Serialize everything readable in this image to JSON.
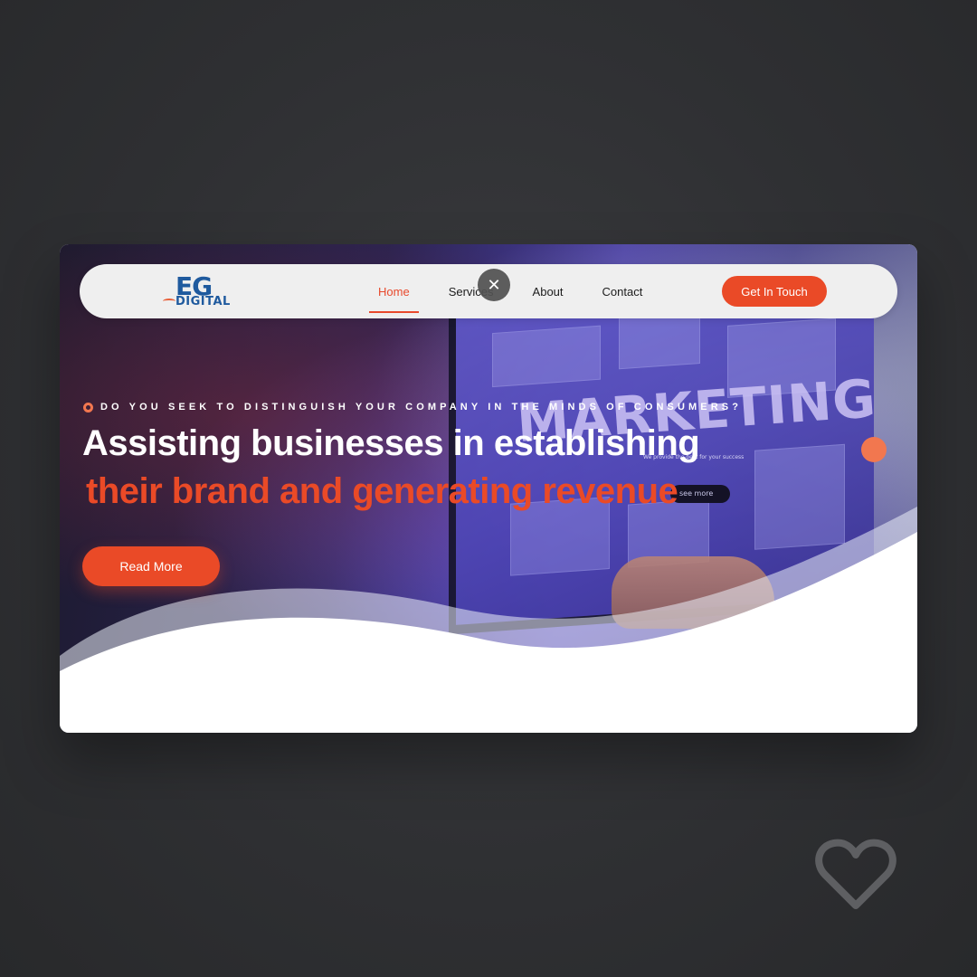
{
  "brand": {
    "logo_main": "EG",
    "logo_sub": "DIGITAL",
    "colors": {
      "accent": "#ea4a27",
      "logo_blue": "#1f5a9e",
      "dot": "#f2774f"
    }
  },
  "nav": {
    "items": [
      {
        "label": "Home",
        "active": true
      },
      {
        "label": "Services",
        "active": false
      },
      {
        "label": "About",
        "active": false
      },
      {
        "label": "Contact",
        "active": false
      }
    ],
    "cta_label": "Get In Touch"
  },
  "overlay": {
    "close_icon": "close-icon",
    "close_glyph": "✕"
  },
  "hero": {
    "eyebrow": "DO YOU SEEK TO DISTINGUISH YOUR COMPANY IN THE MINDS OF CONSUMERS?",
    "headline_line1": "Assisting businesses in establishing",
    "headline_line2": "their brand and generating revenue",
    "button_label": "Read More",
    "background_screen_text": "MARKETING",
    "background_screen_pill": "see more",
    "background_screen_tag": "We provide the best for your success"
  },
  "decor": {
    "like_icon": "heart-icon"
  }
}
